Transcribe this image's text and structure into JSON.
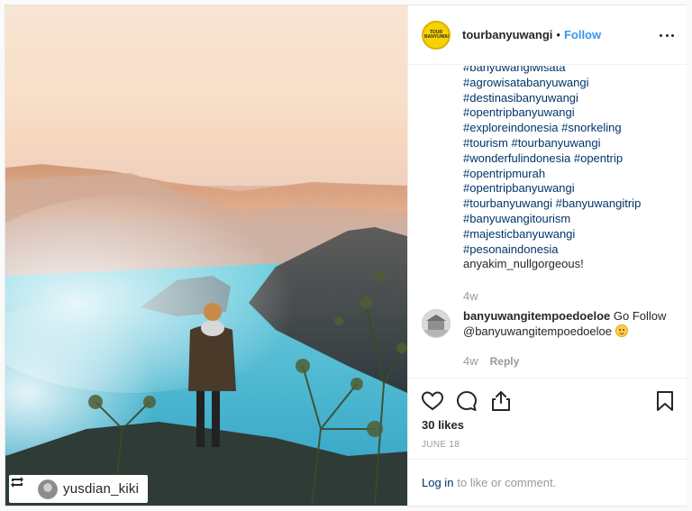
{
  "post": {
    "repost_tag": {
      "username": "yusdian_kiki",
      "icon": "repost-icon"
    }
  },
  "header": {
    "avatar_text": "TOUR BANYUWANGI",
    "username": "tourbanyuwangi",
    "separator": "•",
    "follow_label": "Follow",
    "more_icon": "more-options-icon"
  },
  "caption": {
    "lines": [
      "#banyuwangiwisata",
      "#agrowisatabanyuwangi",
      "#destinasibanyuwangi",
      "#opentripbanyuwangi",
      "#exploreindonesia #snorkeling",
      "#tourism #tourbanyuwangi",
      "#wonderfulindonesia #opentrip",
      "#opentripmurah",
      "#opentripbanyuwangi",
      "#tourbanyuwangi #banyuwangitrip",
      "#banyuwangitourism",
      "#majesticbanyuwangi",
      "#pesonaindonesia"
    ],
    "last_line": "anyakim_nullgorgeous!",
    "time": "4w"
  },
  "comment": {
    "username": "banyuwangitempoedoeloe",
    "text": "Go Follow @banyuwangitempoedoeloe",
    "emoji": "smiling-face-emoji",
    "time": "4w",
    "reply_label": "Reply"
  },
  "actions": {
    "like_icon": "heart-icon",
    "comment_icon": "comment-icon",
    "share_icon": "share-icon",
    "save_icon": "bookmark-icon"
  },
  "likes": "30 likes",
  "date": "JUNE 18",
  "login": {
    "link": "Log in",
    "rest": "to like or comment."
  },
  "colors": {
    "link": "#003569",
    "follow": "#3897f0",
    "muted": "#999999",
    "text": "#262626"
  }
}
